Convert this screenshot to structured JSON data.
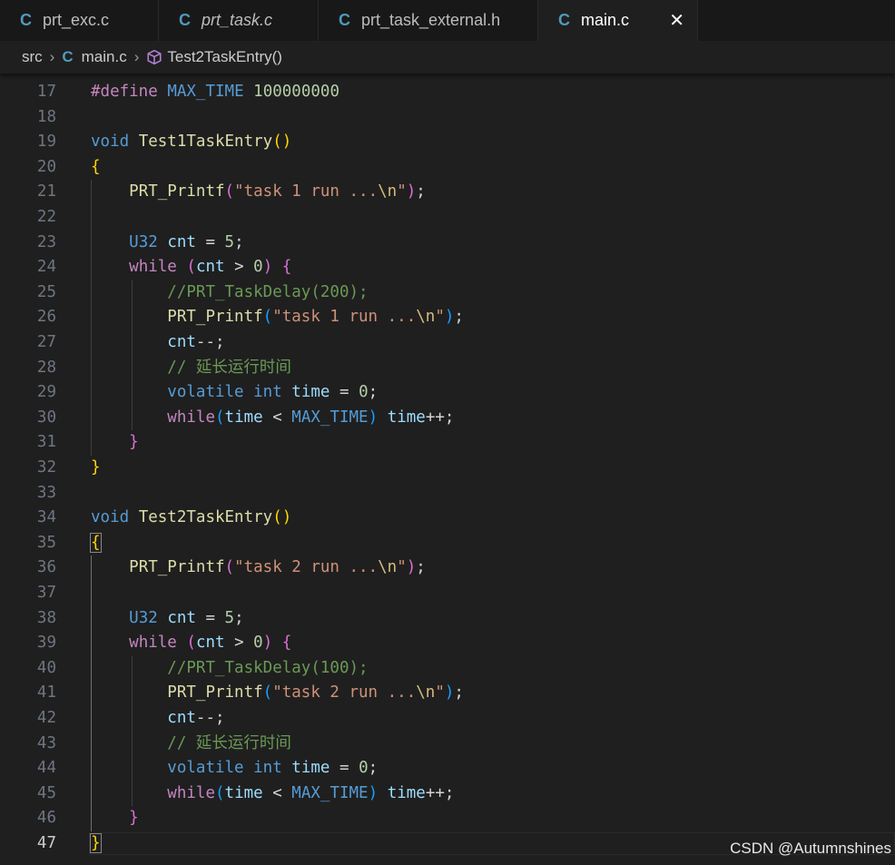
{
  "tabs": [
    {
      "label": "prt_exc.c",
      "icon": "c-file-icon",
      "icon_glyph": "C",
      "italic": false,
      "active": false
    },
    {
      "label": "prt_task.c",
      "icon": "c-file-icon",
      "icon_glyph": "C",
      "italic": true,
      "active": false
    },
    {
      "label": "prt_task_external.h",
      "icon": "c-file-icon",
      "icon_glyph": "C",
      "italic": false,
      "active": false
    },
    {
      "label": "main.c",
      "icon": "c-file-icon",
      "icon_glyph": "C",
      "italic": false,
      "active": true,
      "close_glyph": "✕"
    }
  ],
  "breadcrumb": {
    "folder": "src",
    "separator": "›",
    "file_icon_glyph": "C",
    "file": "main.c",
    "symbol": "Test2TaskEntry()"
  },
  "editor": {
    "current_line": 47,
    "lines": [
      {
        "n": "17",
        "tokens": [
          [
            "k-pre",
            "#define"
          ],
          [
            "k-op",
            " "
          ],
          [
            "k-macro",
            "MAX_TIME"
          ],
          [
            "k-op",
            " "
          ],
          [
            "k-num",
            "100000000"
          ]
        ]
      },
      {
        "n": "18",
        "tokens": []
      },
      {
        "n": "19",
        "tokens": [
          [
            "k-type",
            "void"
          ],
          [
            "k-op",
            " "
          ],
          [
            "k-fn",
            "Test1TaskEntry"
          ],
          [
            "k-p1",
            "()"
          ]
        ]
      },
      {
        "n": "20",
        "tokens": [
          [
            "k-p1",
            "{"
          ]
        ]
      },
      {
        "n": "21",
        "tokens": [
          [
            "k-op",
            "    "
          ],
          [
            "k-fn",
            "PRT_Printf"
          ],
          [
            "k-p2",
            "("
          ],
          [
            "k-str",
            "\"task 1 run ..."
          ],
          [
            "k-esc",
            "\\n"
          ],
          [
            "k-str",
            "\""
          ],
          [
            "k-p2",
            ")"
          ],
          [
            "k-op",
            ";"
          ]
        ]
      },
      {
        "n": "22",
        "tokens": []
      },
      {
        "n": "23",
        "tokens": [
          [
            "k-op",
            "    "
          ],
          [
            "k-type",
            "U32"
          ],
          [
            "k-op",
            " "
          ],
          [
            "k-var",
            "cnt"
          ],
          [
            "k-op",
            " = "
          ],
          [
            "k-num",
            "5"
          ],
          [
            "k-op",
            ";"
          ]
        ]
      },
      {
        "n": "24",
        "tokens": [
          [
            "k-op",
            "    "
          ],
          [
            "k-ctl",
            "while"
          ],
          [
            "k-op",
            " "
          ],
          [
            "k-p2",
            "("
          ],
          [
            "k-var",
            "cnt"
          ],
          [
            "k-op",
            " > "
          ],
          [
            "k-num",
            "0"
          ],
          [
            "k-p2",
            ")"
          ],
          [
            "k-op",
            " "
          ],
          [
            "k-p2",
            "{"
          ]
        ]
      },
      {
        "n": "25",
        "tokens": [
          [
            "k-op",
            "        "
          ],
          [
            "k-cmt",
            "//PRT_TaskDelay(200);"
          ]
        ]
      },
      {
        "n": "26",
        "tokens": [
          [
            "k-op",
            "        "
          ],
          [
            "k-fn",
            "PRT_Printf"
          ],
          [
            "k-p3",
            "("
          ],
          [
            "k-str",
            "\"task 1 run ..."
          ],
          [
            "k-esc",
            "\\n"
          ],
          [
            "k-str",
            "\""
          ],
          [
            "k-p3",
            ")"
          ],
          [
            "k-op",
            ";"
          ]
        ]
      },
      {
        "n": "27",
        "tokens": [
          [
            "k-op",
            "        "
          ],
          [
            "k-var",
            "cnt"
          ],
          [
            "k-op",
            "--;"
          ]
        ]
      },
      {
        "n": "28",
        "tokens": [
          [
            "k-op",
            "        "
          ],
          [
            "k-cmt",
            "// 延长运行时间"
          ]
        ]
      },
      {
        "n": "29",
        "tokens": [
          [
            "k-op",
            "        "
          ],
          [
            "k-type",
            "volatile"
          ],
          [
            "k-op",
            " "
          ],
          [
            "k-type",
            "int"
          ],
          [
            "k-op",
            " "
          ],
          [
            "k-var",
            "time"
          ],
          [
            "k-op",
            " = "
          ],
          [
            "k-num",
            "0"
          ],
          [
            "k-op",
            ";"
          ]
        ]
      },
      {
        "n": "30",
        "tokens": [
          [
            "k-op",
            "        "
          ],
          [
            "k-ctl",
            "while"
          ],
          [
            "k-p3",
            "("
          ],
          [
            "k-var",
            "time"
          ],
          [
            "k-op",
            " < "
          ],
          [
            "k-macro",
            "MAX_TIME"
          ],
          [
            "k-p3",
            ")"
          ],
          [
            "k-op",
            " "
          ],
          [
            "k-var",
            "time"
          ],
          [
            "k-op",
            "++;"
          ]
        ]
      },
      {
        "n": "31",
        "tokens": [
          [
            "k-op",
            "    "
          ],
          [
            "k-p2",
            "}"
          ]
        ]
      },
      {
        "n": "32",
        "tokens": [
          [
            "k-p1",
            "}"
          ]
        ]
      },
      {
        "n": "33",
        "tokens": []
      },
      {
        "n": "34",
        "tokens": [
          [
            "k-type",
            "void"
          ],
          [
            "k-op",
            " "
          ],
          [
            "k-fn",
            "Test2TaskEntry"
          ],
          [
            "k-p1",
            "()"
          ]
        ]
      },
      {
        "n": "35",
        "tokens": [
          [
            "k-p1 bm",
            "{"
          ]
        ]
      },
      {
        "n": "36",
        "tokens": [
          [
            "k-op",
            "    "
          ],
          [
            "k-fn",
            "PRT_Printf"
          ],
          [
            "k-p2",
            "("
          ],
          [
            "k-str",
            "\"task 2 run ..."
          ],
          [
            "k-esc",
            "\\n"
          ],
          [
            "k-str",
            "\""
          ],
          [
            "k-p2",
            ")"
          ],
          [
            "k-op",
            ";"
          ]
        ]
      },
      {
        "n": "37",
        "tokens": []
      },
      {
        "n": "38",
        "tokens": [
          [
            "k-op",
            "    "
          ],
          [
            "k-type",
            "U32"
          ],
          [
            "k-op",
            " "
          ],
          [
            "k-var",
            "cnt"
          ],
          [
            "k-op",
            " = "
          ],
          [
            "k-num",
            "5"
          ],
          [
            "k-op",
            ";"
          ]
        ]
      },
      {
        "n": "39",
        "tokens": [
          [
            "k-op",
            "    "
          ],
          [
            "k-ctl",
            "while"
          ],
          [
            "k-op",
            " "
          ],
          [
            "k-p2",
            "("
          ],
          [
            "k-var",
            "cnt"
          ],
          [
            "k-op",
            " > "
          ],
          [
            "k-num",
            "0"
          ],
          [
            "k-p2",
            ")"
          ],
          [
            "k-op",
            " "
          ],
          [
            "k-p2",
            "{"
          ]
        ]
      },
      {
        "n": "40",
        "tokens": [
          [
            "k-op",
            "        "
          ],
          [
            "k-cmt",
            "//PRT_TaskDelay(100);"
          ]
        ]
      },
      {
        "n": "41",
        "tokens": [
          [
            "k-op",
            "        "
          ],
          [
            "k-fn",
            "PRT_Printf"
          ],
          [
            "k-p3",
            "("
          ],
          [
            "k-str",
            "\"task 2 run ..."
          ],
          [
            "k-esc",
            "\\n"
          ],
          [
            "k-str",
            "\""
          ],
          [
            "k-p3",
            ")"
          ],
          [
            "k-op",
            ";"
          ]
        ]
      },
      {
        "n": "42",
        "tokens": [
          [
            "k-op",
            "        "
          ],
          [
            "k-var",
            "cnt"
          ],
          [
            "k-op",
            "--;"
          ]
        ]
      },
      {
        "n": "43",
        "tokens": [
          [
            "k-op",
            "        "
          ],
          [
            "k-cmt",
            "// 延长运行时间"
          ]
        ]
      },
      {
        "n": "44",
        "tokens": [
          [
            "k-op",
            "        "
          ],
          [
            "k-type",
            "volatile"
          ],
          [
            "k-op",
            " "
          ],
          [
            "k-type",
            "int"
          ],
          [
            "k-op",
            " "
          ],
          [
            "k-var",
            "time"
          ],
          [
            "k-op",
            " = "
          ],
          [
            "k-num",
            "0"
          ],
          [
            "k-op",
            ";"
          ]
        ]
      },
      {
        "n": "45",
        "tokens": [
          [
            "k-op",
            "        "
          ],
          [
            "k-ctl",
            "while"
          ],
          [
            "k-p3",
            "("
          ],
          [
            "k-var",
            "time"
          ],
          [
            "k-op",
            " < "
          ],
          [
            "k-macro",
            "MAX_TIME"
          ],
          [
            "k-p3",
            ")"
          ],
          [
            "k-op",
            " "
          ],
          [
            "k-var",
            "time"
          ],
          [
            "k-op",
            "++;"
          ]
        ]
      },
      {
        "n": "46",
        "tokens": [
          [
            "k-op",
            "    "
          ],
          [
            "k-p2",
            "}"
          ]
        ]
      },
      {
        "n": "47",
        "tokens": [
          [
            "k-p1 bm",
            "}"
          ]
        ]
      }
    ]
  },
  "watermark": "CSDN @Autumnshines",
  "colors": {
    "background": "#1f1f1f",
    "tab_background": "#181818",
    "c_icon": "#519aba",
    "symbol_icon": "#b180d7"
  }
}
